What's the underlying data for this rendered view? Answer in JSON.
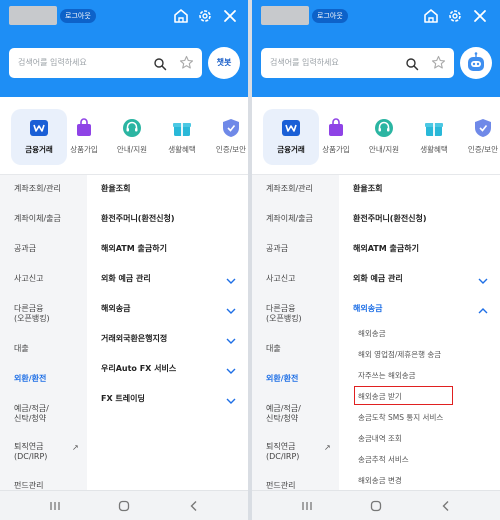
{
  "header": {
    "logout_label": "로그아웃",
    "search_placeholder": "검색어를 입력하세요",
    "chatbot_label": "챗봇",
    "icons": [
      "home-icon",
      "gear-icon",
      "close-icon",
      "search-icon",
      "star-icon",
      "chatbot-robot-icon"
    ]
  },
  "categories": [
    {
      "label": "금융거래",
      "icon": "wallet-icon"
    },
    {
      "label": "상품가입",
      "icon": "shopping-bag-icon"
    },
    {
      "label": "안내/지원",
      "icon": "headset-icon"
    },
    {
      "label": "생활혜택",
      "icon": "gift-icon"
    },
    {
      "label": "인증/보안",
      "icon": "shield-icon"
    }
  ],
  "left_menu": [
    {
      "label": "계좌조회/관리"
    },
    {
      "label": "계좌이체/출금"
    },
    {
      "label": "공과금"
    },
    {
      "label": "사고신고"
    },
    {
      "label": "다른금융\n(오픈뱅킹)"
    },
    {
      "label": "대출"
    },
    {
      "label": "외환/환전"
    },
    {
      "label": "예금/적금/\n신탁/청약"
    },
    {
      "label": "퇴직연금\n(DC/IRP)",
      "arrow": "↗"
    },
    {
      "label": "펀드관리"
    }
  ],
  "left_screen": {
    "menu_items": [
      {
        "label": "환율조회"
      },
      {
        "label": "환전주머니(환전신청)"
      },
      {
        "label": "해외ATM 출금하기"
      },
      {
        "label": "외화 예금 관리"
      },
      {
        "label": "해외송금"
      },
      {
        "label": "거래외국환은행지정"
      },
      {
        "label": "우리Auto FX 서비스"
      },
      {
        "label": "FX 트레이딩"
      }
    ]
  },
  "right_screen": {
    "menu_items": [
      {
        "label": "환율조회"
      },
      {
        "label": "환전주머니(환전신청)"
      },
      {
        "label": "해외ATM 출금하기"
      },
      {
        "label": "외화 예금 관리"
      },
      {
        "label": "해외송금"
      }
    ],
    "sub_items": [
      {
        "label": "해외송금"
      },
      {
        "label": "해외 영업점/제휴은행 송금"
      },
      {
        "label": "자주쓰는 해외송금"
      },
      {
        "label": "해외송금 받기"
      },
      {
        "label": "송금도착 SMS 통지 서비스"
      },
      {
        "label": "송금내역 조회"
      },
      {
        "label": "송금추적 서비스"
      },
      {
        "label": "해외송금 변경"
      }
    ]
  },
  "colors": {
    "header_blue": "#1e8ef5",
    "active_blue": "#1e6fe6",
    "highlight_red": "#e02020"
  }
}
